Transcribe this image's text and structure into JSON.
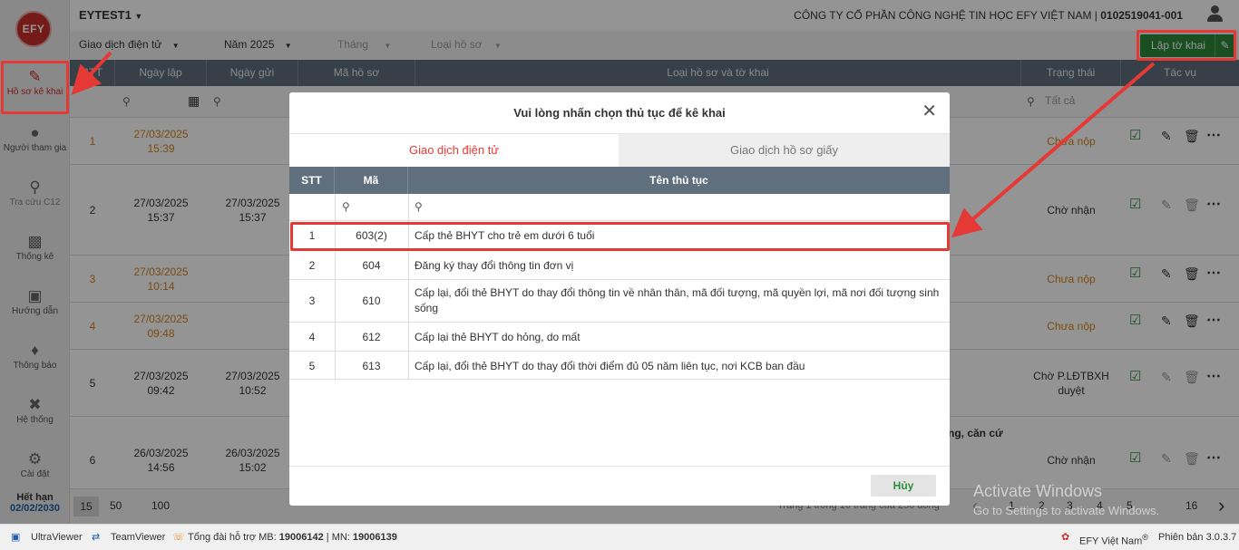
{
  "sidebar": {
    "logo_text": "EFY",
    "items": [
      {
        "label": "Hồ sơ kê khai",
        "icon": "edit-document-icon"
      },
      {
        "label": "Người tham gia",
        "icon": "user-icon"
      },
      {
        "label": "Tra cứu C12",
        "icon": "search-icon"
      },
      {
        "label": "Thống kê",
        "icon": "bar-chart-icon"
      },
      {
        "label": "Hướng dẫn",
        "icon": "book-icon"
      },
      {
        "label": "Thông báo",
        "icon": "bell-icon"
      },
      {
        "label": "Hệ thống",
        "icon": "tools-icon"
      },
      {
        "label": "Cài đặt",
        "icon": "gear-icon"
      }
    ],
    "expire_label": "Hết hạn",
    "expire_date": "02/02/2030"
  },
  "topbar": {
    "account": "EYTEST1",
    "company": "CÔNG TY CỔ PHẦN CÔNG NGHỆ TIN HỌC EFY VIỆT NAM | ",
    "tax_code": "0102519041-001"
  },
  "filters": {
    "type": "Giao dịch điện tử",
    "year": "Năm 2025",
    "month": "Tháng",
    "record_type": "Loại hồ sơ",
    "create_button": "Lập tờ khai"
  },
  "table": {
    "headers": [
      "STT",
      "Ngày lập",
      "Ngày gửi",
      "Mã hồ sơ",
      "Loại hồ sơ và tờ khai",
      "Trạng thái",
      "Tác vụ"
    ],
    "status_filter": "Tất cả",
    "rows": [
      {
        "stt": "1",
        "created_date": "27/03/2025",
        "created_time": "15:39",
        "sent_date": "",
        "sent_time": "",
        "status": "Chưa nộp"
      },
      {
        "stt": "2",
        "created_date": "27/03/2025",
        "created_time": "15:37",
        "sent_date": "27/03/2025",
        "sent_time": "15:37",
        "status": "Chờ nhận"
      },
      {
        "stt": "3",
        "created_date": "27/03/2025",
        "created_time": "10:14",
        "sent_date": "",
        "sent_time": "",
        "status": "Chưa nộp"
      },
      {
        "stt": "4",
        "created_date": "27/03/2025",
        "created_time": "09:48",
        "sent_date": "",
        "sent_time": "",
        "status": "Chưa nộp"
      },
      {
        "stt": "5",
        "created_date": "27/03/2025",
        "created_time": "09:42",
        "sent_date": "27/03/2025",
        "sent_time": "10:52",
        "status": "Chờ P.LĐTBXH duyệt"
      },
      {
        "stt": "6",
        "created_date": "26/03/2025",
        "created_time": "14:56",
        "sent_date": "26/03/2025",
        "sent_time": "15:02",
        "status": "Chờ nhận"
      }
    ],
    "row6_partial_text": "ng, căn cứ",
    "page_sizes": [
      "15",
      "50",
      "100"
    ],
    "page_info": "Trang 1 trong 16 trang của 230 dòng",
    "pages": [
      "1",
      "2",
      "3",
      "4",
      "5",
      "16"
    ]
  },
  "modal": {
    "title": "Vui lòng nhấn chọn thủ tục để kê khai",
    "tabs": [
      "Giao dịch điện tử",
      "Giao dịch hồ sơ giấy"
    ],
    "headers": [
      "STT",
      "Mã",
      "Tên thủ tục"
    ],
    "rows": [
      {
        "stt": "1",
        "code": "603(2)",
        "name": "Cấp thẻ BHYT cho trẻ em dưới 6 tuổi"
      },
      {
        "stt": "2",
        "code": "604",
        "name": "Đăng ký thay đổi thông tin đơn vị"
      },
      {
        "stt": "3",
        "code": "610",
        "name": "Cấp lại, đổi thẻ BHYT do thay đổi thông tin về nhân thân, mã đối tượng, mã quyền lợi, mã nơi đối tượng sinh sống"
      },
      {
        "stt": "4",
        "code": "612",
        "name": "Cấp lại thẻ BHYT do hỏng, do mất"
      },
      {
        "stt": "5",
        "code": "613",
        "name": "Cấp lại, đổi thẻ BHYT do thay đổi thời điểm đủ 05 năm liên tục, nơi KCB ban đầu"
      }
    ],
    "cancel": "Hủy"
  },
  "bottombar": {
    "ultraviewer": "UltraViewer",
    "teamviewer": "TeamViewer",
    "hotline_label": "Tổng đài hỗ trợ MB: ",
    "hotline_mb": "19006142",
    "hotline_sep": " | MN: ",
    "hotline_mn": "19006139",
    "brand": "EFY Việt Nam",
    "brand_mark": "®",
    "version": "Phiên bản 3.0.3.7"
  },
  "watermark": {
    "line1": "Activate Windows",
    "line2": "Go to Settings to activate Windows."
  },
  "colors": {
    "accent": "#e53935",
    "header": "#5f6f7d",
    "green": "#2e8b3a",
    "orange": "#d4821c",
    "link": "#1f5fa8"
  }
}
